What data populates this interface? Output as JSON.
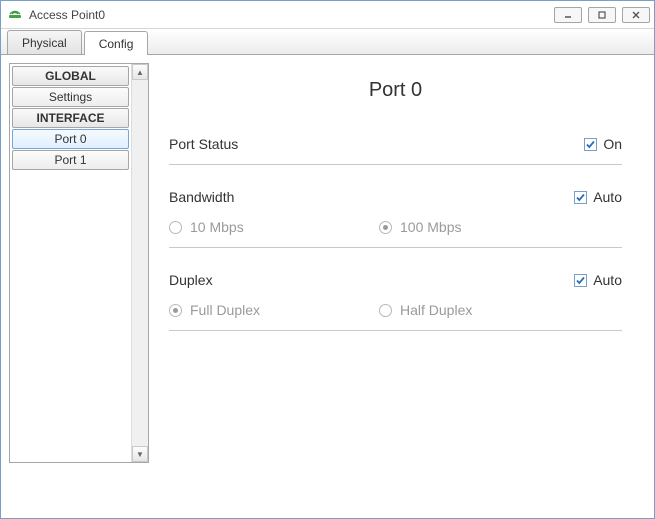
{
  "window": {
    "title": "Access Point0"
  },
  "tabs": {
    "physical": "Physical",
    "config": "Config"
  },
  "sidebar": {
    "global_header": "GLOBAL",
    "settings": "Settings",
    "interface_header": "INTERFACE",
    "port0": "Port 0",
    "port1": "Port 1"
  },
  "panel": {
    "title": "Port 0",
    "port_status_label": "Port Status",
    "port_status_value": "On",
    "bandwidth_label": "Bandwidth",
    "bandwidth_auto": "Auto",
    "bandwidth_opts": {
      "ten": "10 Mbps",
      "hundred": "100 Mbps"
    },
    "duplex_label": "Duplex",
    "duplex_auto": "Auto",
    "duplex_opts": {
      "full": "Full Duplex",
      "half": "Half Duplex"
    }
  }
}
